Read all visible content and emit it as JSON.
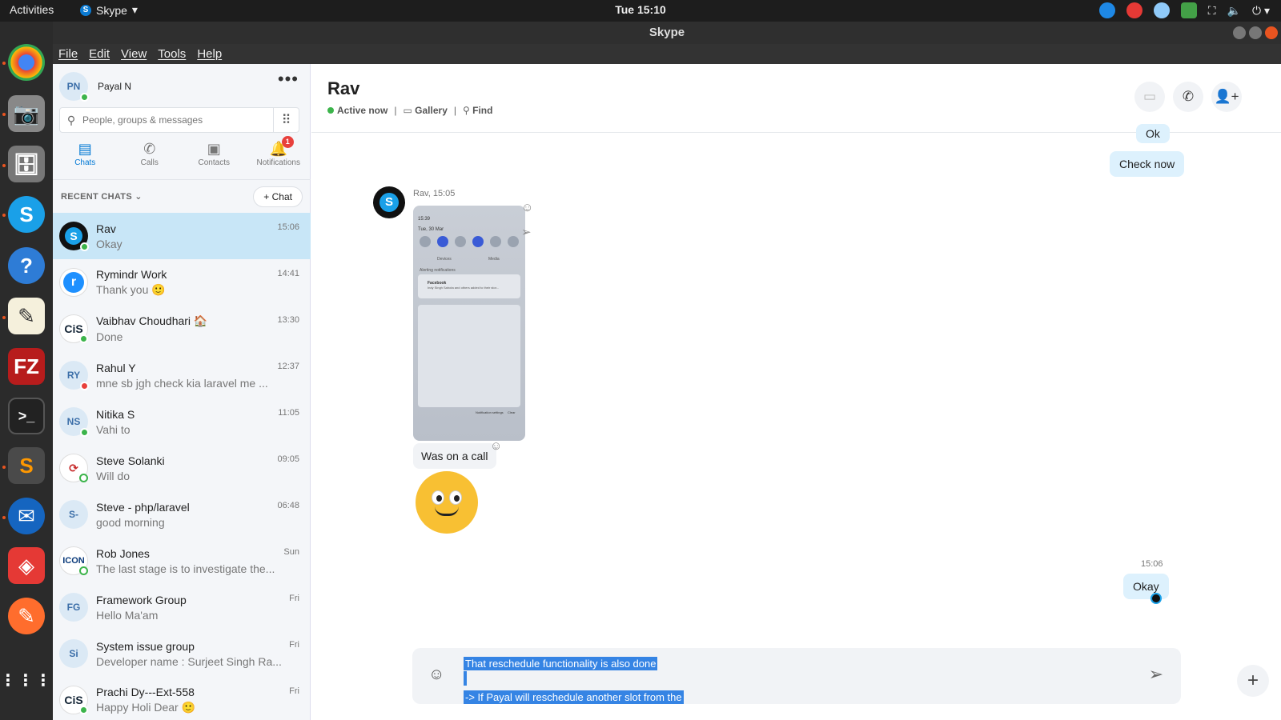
{
  "topbar": {
    "activities": "Activities",
    "app_name": "Skype",
    "clock": "Tue 15:10"
  },
  "window": {
    "title": "Skype"
  },
  "menu": [
    "File",
    "Edit",
    "View",
    "Tools",
    "Help"
  ],
  "profile": {
    "initials": "PN",
    "name": "Payal N"
  },
  "search": {
    "placeholder": "People, groups & messages"
  },
  "nav": [
    {
      "label": "Chats",
      "icon": "chat-icon",
      "active": true
    },
    {
      "label": "Calls",
      "icon": "phone-icon"
    },
    {
      "label": "Contacts",
      "icon": "contacts-icon"
    },
    {
      "label": "Notifications",
      "icon": "bell-icon",
      "badge": "1"
    }
  ],
  "recent": {
    "label": "RECENT CHATS",
    "new_chat": "Chat"
  },
  "chats": [
    {
      "name": "Rav",
      "preview": "Okay",
      "time": "15:06",
      "avatar": "skype",
      "status": "online",
      "active": true
    },
    {
      "name": "Rymindr Work",
      "preview": "Thank you 🙂",
      "time": "14:41",
      "avatar": "rymindr"
    },
    {
      "name": "Vaibhav Choudhari 🏠",
      "preview": "Done",
      "time": "13:30",
      "avatar": "cis",
      "status": "online"
    },
    {
      "name": "Rahul Y",
      "preview": "mne sb jgh check kia laravel me ...",
      "time": "12:37",
      "initials": "RY",
      "status": "busy"
    },
    {
      "name": "Nitika S",
      "preview": "Vahi to",
      "time": "11:05",
      "initials": "NS",
      "status": "online"
    },
    {
      "name": "Steve Solanki",
      "preview": "Will do",
      "time": "09:05",
      "avatar": "logo",
      "status": "away"
    },
    {
      "name": "Steve - php/laravel",
      "preview": "good morning",
      "time": "06:48",
      "initials": "S-"
    },
    {
      "name": "Rob Jones",
      "preview": "The last stage is to investigate the...",
      "time": "Sun",
      "avatar": "icon",
      "status": "away"
    },
    {
      "name": "Framework Group",
      "preview": "Hello Ma'am",
      "time": "Fri",
      "initials": "FG"
    },
    {
      "name": "System issue group",
      "preview": "Developer name : Surjeet Singh Ra...",
      "time": "Fri",
      "initials": "Si"
    },
    {
      "name": "Prachi Dy---Ext-558",
      "preview": "Happy Holi Dear 🙂",
      "time": "Fri",
      "avatar": "cis",
      "status": "online"
    }
  ],
  "conversation": {
    "title": "Rav",
    "status": "Active now",
    "gallery": "Gallery",
    "find": "Find",
    "msg_ok_top": "Ok",
    "msg_check_now": "Check now",
    "sender_meta": "Rav, 15:05",
    "msg_was_on_call": "Was on a call",
    "time_out": "15:06",
    "msg_okay": "Okay"
  },
  "screenshot_thumb": {
    "time": "15:39",
    "date": "Tue, 30 Mar",
    "devices": "Devices",
    "media": "Media",
    "alerting": "Alerting notifications",
    "fb_title": "Facebook",
    "fb_text": "Indy Singh Sahota and others added to their stor...",
    "notif_settings": "Notification settings",
    "clear": "Clear"
  },
  "composer": {
    "line1": "That reschedule functionality is also done",
    "line2": "-> If Payal will reschedule another slot from the"
  }
}
